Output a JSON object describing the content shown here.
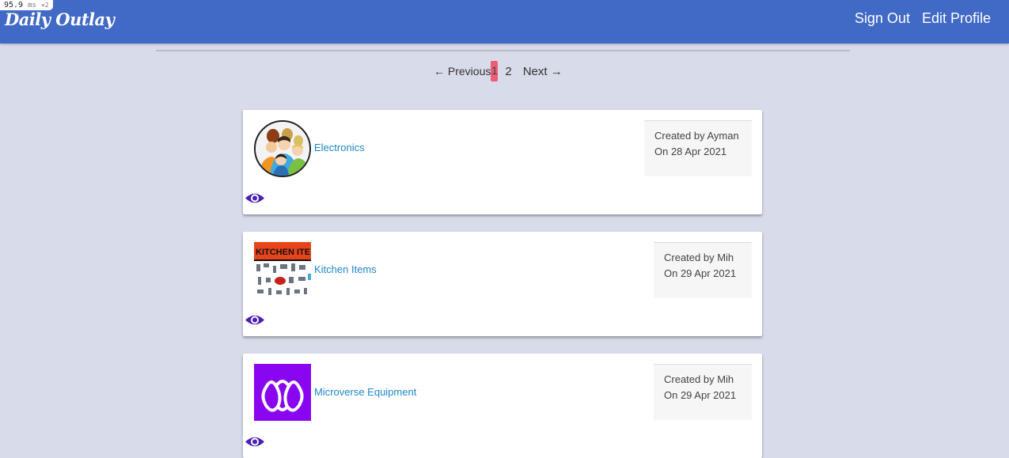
{
  "perf": {
    "value": "95.9",
    "unit": "ms",
    "mult": "×2"
  },
  "navbar": {
    "brand": "Daily Outlay",
    "links": [
      "Sign Out",
      "Edit Profile"
    ]
  },
  "pagination": {
    "previous": "← Previous",
    "current": "1",
    "page2": "2",
    "next": "Next →"
  },
  "groups": [
    {
      "name": "Electronics",
      "created_by": "Created by Ayman",
      "created_on": "On 28 Apr 2021",
      "icon": "people-group-icon"
    },
    {
      "name": "Kitchen Items",
      "created_by": "Created by Mih",
      "created_on": "On 29 Apr 2021",
      "icon": "kitchen-items-image",
      "image_text": "KITCHEN ITE"
    },
    {
      "name": "Microverse Equipment",
      "created_by": "Created by Mih",
      "created_on": "On 29 Apr 2021",
      "icon": "microverse-logo"
    }
  ],
  "colors": {
    "navbar": "#4169c6",
    "link": "#1d87c9",
    "eye": "#4b1fb3",
    "current_page": "#ee5d73",
    "microverse": "#8a05f0"
  }
}
